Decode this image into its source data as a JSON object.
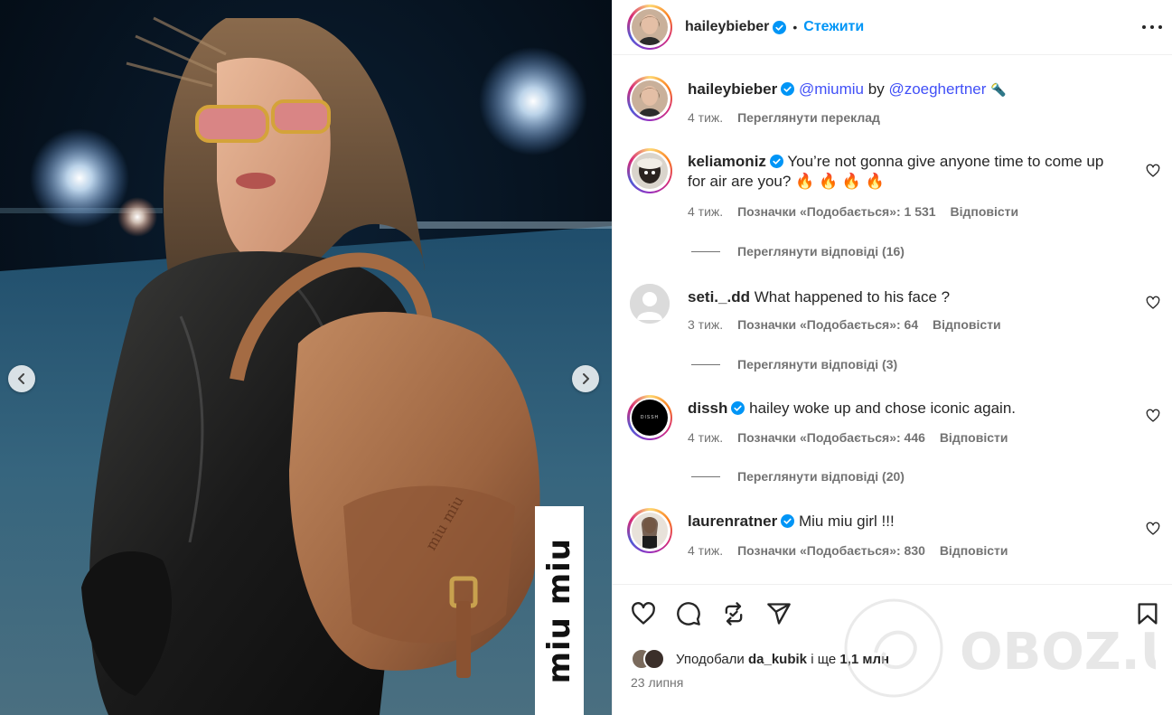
{
  "post": {
    "author": "haileybieber",
    "follow_label": "Стежити",
    "separator": "•",
    "brand_text": "miu miu"
  },
  "caption": {
    "username": "haileybieber",
    "mention1": "@miumiu",
    "by_word": "by",
    "mention2": "@zoeghertner",
    "emoji": "🔦",
    "time": "4 тиж.",
    "translate_label": "Переглянути переклад"
  },
  "comments": [
    {
      "username": "keliamoniz",
      "verified": true,
      "text": "You’re not gonna give anyone time to come up for air are you? 🔥 🔥 🔥 🔥",
      "time": "4 тиж.",
      "likes": "Позначки «Подобається»: 1 531",
      "reply_label": "Відповісти",
      "view_replies": "Переглянути відповіді (16)"
    },
    {
      "username": "seti._.dd",
      "verified": false,
      "text": "What happened to his face ?",
      "time": "3 тиж.",
      "likes": "Позначки «Подобається»: 64",
      "reply_label": "Відповісти",
      "view_replies": "Переглянути відповіді (3)"
    },
    {
      "username": "dissh",
      "verified": true,
      "text": "hailey woke up and chose iconic again.",
      "time": "4 тиж.",
      "likes": "Позначки «Подобається»: 446",
      "reply_label": "Відповісти",
      "view_replies": "Переглянути відповіді (20)",
      "avatar_text": "DISSH"
    },
    {
      "username": "laurenratner",
      "verified": true,
      "text": "Miu miu girl !!!",
      "time": "4 тиж.",
      "likes": "Позначки «Подобається»: 830",
      "reply_label": "Відповісти"
    }
  ],
  "footer": {
    "liked_prefix": "Уподобали",
    "liked_user": "da_kubik",
    "liked_suffix": "і ще",
    "liked_count": "1,1 млн",
    "date": "23 липня"
  },
  "watermark_text": "OBOZ.UA",
  "colors": {
    "accent": "#0095f6",
    "verified": "#0095f6",
    "mention": "#4150f7",
    "secondary_text": "#737373"
  },
  "icons": {
    "prev": "chevron-left-icon",
    "next": "chevron-right-icon",
    "more": "more-horizontal-icon",
    "like": "heart-icon",
    "comment": "comment-bubble-icon",
    "repost": "repost-icon",
    "share": "paper-plane-icon",
    "save": "bookmark-icon"
  }
}
